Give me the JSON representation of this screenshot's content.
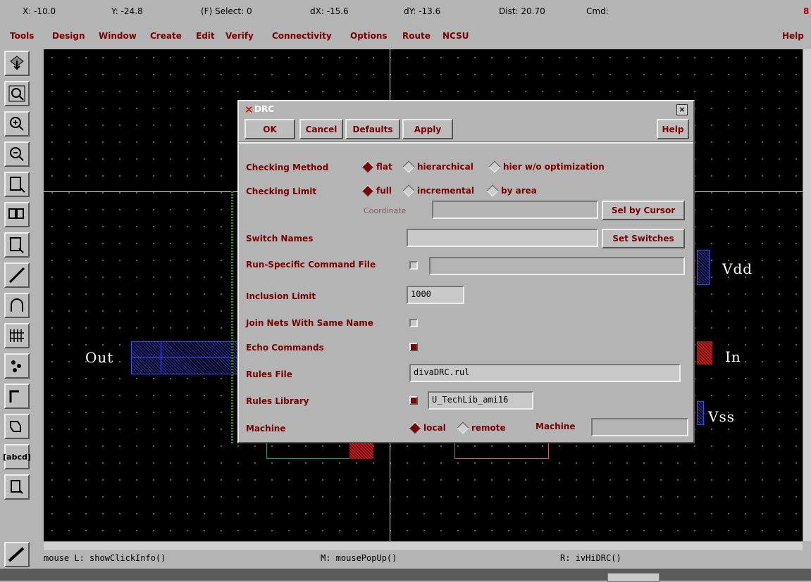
{
  "status": {
    "x": "X: -10.0",
    "y": "Y: -24.8",
    "select": "(F) Select: 0",
    "dx": "dX: -15.6",
    "dy": "dY: -13.6",
    "dist": "Dist: 20.70",
    "cmd": "Cmd:",
    "num": "8"
  },
  "menu": {
    "items": [
      "Tools",
      "Design",
      "Window",
      "Create",
      "Edit",
      "Verify",
      "Connectivity",
      "Options",
      "Route",
      "NCSU"
    ],
    "help": "Help"
  },
  "toolbar": {
    "abcd_label": "[abcd]"
  },
  "canvas_labels": {
    "out": "Out",
    "vdd": "Vdd",
    "in": "In",
    "vss": "Vss"
  },
  "dialog": {
    "title": "DRC",
    "buttons": {
      "ok": "OK",
      "cancel": "Cancel",
      "defaults": "Defaults",
      "apply": "Apply",
      "help": "Help"
    },
    "checking_method": {
      "label": "Checking Method",
      "options": [
        "flat",
        "hierarchical",
        "hier w/o optimization"
      ],
      "selected": "flat"
    },
    "checking_limit": {
      "label": "Checking Limit",
      "options": [
        "full",
        "incremental",
        "by area"
      ],
      "selected": "full"
    },
    "coordinate": {
      "label": "Coordinate",
      "value": "",
      "button": "Sel by Cursor"
    },
    "switch_names": {
      "label": "Switch Names",
      "value": "",
      "button": "Set Switches"
    },
    "run_specific": {
      "label": "Run-Specific Command File",
      "checked": false,
      "value": ""
    },
    "inclusion_limit": {
      "label": "Inclusion Limit",
      "value": "1000"
    },
    "join_nets": {
      "label": "Join Nets With Same Name",
      "checked": false
    },
    "echo_commands": {
      "label": "Echo Commands",
      "checked": true
    },
    "rules_file": {
      "label": "Rules File",
      "value": "divaDRC.rul"
    },
    "rules_library": {
      "label": "Rules Library",
      "checked": true,
      "value": "U_TechLib_ami16"
    },
    "machine": {
      "label": "Machine",
      "options": [
        "local",
        "remote"
      ],
      "selected": "local",
      "field_label": "Machine",
      "value": ""
    }
  },
  "bottom": {
    "left": "mouse L: showClickInfo()",
    "middle": "M: mousePopUp()",
    "right": "R: ivHiDRC()"
  }
}
